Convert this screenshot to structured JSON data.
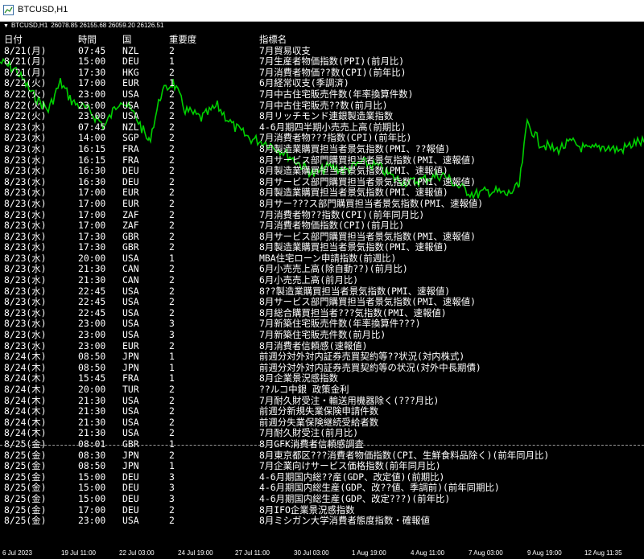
{
  "window": {
    "title": "BTCUSD,H1",
    "chart_header": {
      "symbol": "BTCUSD,H1",
      "ohlc": "26078.85 26155.68 26059.20 26126.51"
    }
  },
  "colors": {
    "background": "#000000",
    "price_line": "#00d000",
    "text": "#ffffff"
  },
  "table": {
    "headers": {
      "date": "日付",
      "time": "時間",
      "country": "国",
      "importance": "重要度",
      "indicator": "指標名"
    },
    "rows": [
      {
        "date": "8/21(月)",
        "time": "07:45",
        "country": "NZL",
        "importance": "2",
        "name": "7月貿易収支"
      },
      {
        "date": "8/21(月)",
        "time": "15:00",
        "country": "DEU",
        "importance": "1",
        "name": "7月生産者物価指数(PPI)(前月比)"
      },
      {
        "date": "8/21(月)",
        "time": "17:30",
        "country": "HKG",
        "importance": "2",
        "name": "7月消費者物価??数(CPI)(前年比)"
      },
      {
        "date": "8/22(火)",
        "time": "17:00",
        "country": "EUR",
        "importance": "1",
        "name": "6月経常収支(季調済)"
      },
      {
        "date": "8/22(火)",
        "time": "23:00",
        "country": "USA",
        "importance": "2",
        "name": "7月中古住宅販売件数(年率換算件数)"
      },
      {
        "date": "8/22(火)",
        "time": "23:00",
        "country": "USA",
        "importance": "2",
        "name": "7月中古住宅販売??数(前月比)"
      },
      {
        "date": "8/22(火)",
        "time": "23:00",
        "country": "USA",
        "importance": "2",
        "name": "8月リッチモンド連銀製造業指数"
      },
      {
        "date": "8/23(水)",
        "time": "07:45",
        "country": "NZL",
        "importance": "2",
        "name": "4-6月期四半期小売売上高(前期比)"
      },
      {
        "date": "8/23(水)",
        "time": "14:00",
        "country": "SGP",
        "importance": "2",
        "name": "7月消費者物???指数(CPI)(前年比)"
      },
      {
        "date": "8/23(水)",
        "time": "16:15",
        "country": "FRA",
        "importance": "2",
        "name": "8月製造業購買担当者景気指数(PMI、??報値)"
      },
      {
        "date": "8/23(水)",
        "time": "16:15",
        "country": "FRA",
        "importance": "2",
        "name": "8月サービス部門購買担当者景気指数(PMI、速報値)"
      },
      {
        "date": "8/23(水)",
        "time": "16:30",
        "country": "DEU",
        "importance": "2",
        "name": "8月製造業購買担当者景気指数(PMI、速報値)"
      },
      {
        "date": "8/23(水)",
        "time": "16:30",
        "country": "DEU",
        "importance": "2",
        "name": "8月サービス部門購買担当者景気指数(PMI、速報値)"
      },
      {
        "date": "8/23(水)",
        "time": "17:00",
        "country": "EUR",
        "importance": "2",
        "name": "8月製造業購買担当者景気指数(PMI、速報値)"
      },
      {
        "date": "8/23(水)",
        "time": "17:00",
        "country": "EUR",
        "importance": "2",
        "name": "8月サー???ス部門購買担当者景気指数(PMI、速報値)"
      },
      {
        "date": "8/23(水)",
        "time": "17:00",
        "country": "ZAF",
        "importance": "2",
        "name": "7月消費者物??指数(CPI)(前年同月比)"
      },
      {
        "date": "8/23(水)",
        "time": "17:00",
        "country": "ZAF",
        "importance": "2",
        "name": "7月消費者物価指数(CPI)(前月比)"
      },
      {
        "date": "8/23(水)",
        "time": "17:30",
        "country": "GBR",
        "importance": "2",
        "name": "8月サービス部門購買担当者景気指数(PMI、速報値)"
      },
      {
        "date": "8/23(水)",
        "time": "17:30",
        "country": "GBR",
        "importance": "2",
        "name": "8月製造業購買担当者景気指数(PMI、速報値)"
      },
      {
        "date": "8/23(水)",
        "time": "20:00",
        "country": "USA",
        "importance": "1",
        "name": "MBA住宅ローン申請指数(前週比)"
      },
      {
        "date": "8/23(水)",
        "time": "21:30",
        "country": "CAN",
        "importance": "2",
        "name": "6月小売売上高(除自動??)(前月比)"
      },
      {
        "date": "8/23(水)",
        "time": "21:30",
        "country": "CAN",
        "importance": "2",
        "name": "6月小売売上高(前月比)"
      },
      {
        "date": "8/23(水)",
        "time": "22:45",
        "country": "USA",
        "importance": "2",
        "name": "8??製造業購買担当者景気指数(PMI、速報値)"
      },
      {
        "date": "8/23(水)",
        "time": "22:45",
        "country": "USA",
        "importance": "2",
        "name": "8月サービス部門購買担当者景気指数(PMI、速報値)"
      },
      {
        "date": "8/23(水)",
        "time": "22:45",
        "country": "USA",
        "importance": "2",
        "name": "8月総合購買担当者???気指数(PMI、速報値)"
      },
      {
        "date": "8/23(水)",
        "time": "23:00",
        "country": "USA",
        "importance": "3",
        "name": "7月新築住宅販売件数(年率換算件???)"
      },
      {
        "date": "8/23(水)",
        "time": "23:00",
        "country": "USA",
        "importance": "3",
        "name": "7月新築住宅販売件数(前月比)"
      },
      {
        "date": "8/23(水)",
        "time": "23:00",
        "country": "EUR",
        "importance": "2",
        "name": "8月消費者信頼感(速報値)"
      },
      {
        "date": "8/24(木)",
        "time": "08:50",
        "country": "JPN",
        "importance": "1",
        "name": "前週分対外対内証券売買契約等??状況(対内株式)"
      },
      {
        "date": "8/24(木)",
        "time": "08:50",
        "country": "JPN",
        "importance": "1",
        "name": "前週分対外対内証券売買契約等の状況(対外中長期債)"
      },
      {
        "date": "8/24(木)",
        "time": "15:45",
        "country": "FRA",
        "importance": "1",
        "name": "8月企業景況感指数"
      },
      {
        "date": "8/24(木)",
        "time": "20:00",
        "country": "TUR",
        "importance": "2",
        "name": "??ルコ中銀 政策金利"
      },
      {
        "date": "8/24(木)",
        "time": "21:30",
        "country": "USA",
        "importance": "2",
        "name": "7月耐久財受注・輸送用機器除く(???月比)"
      },
      {
        "date": "8/24(木)",
        "time": "21:30",
        "country": "USA",
        "importance": "2",
        "name": "前週分新規失業保険申請件数"
      },
      {
        "date": "8/24(木)",
        "time": "21:30",
        "country": "USA",
        "importance": "2",
        "name": "前週分失業保険継続受給者数"
      },
      {
        "date": "8/24(木)",
        "time": "21:30",
        "country": "USA",
        "importance": "2",
        "name": "7月耐久財受注(前月比)"
      },
      {
        "date": "8/25(金)",
        "time": "08:01",
        "country": "GBR",
        "importance": "1",
        "name": "8月GFK消費者信頼感調査"
      },
      {
        "date": "8/25(金)",
        "time": "08:30",
        "country": "JPN",
        "importance": "2",
        "name": "8月東京都区???消費者物価指数(CPI、生鮮食料品除く)(前年同月比)"
      },
      {
        "date": "8/25(金)",
        "time": "08:50",
        "country": "JPN",
        "importance": "1",
        "name": "7月企業向けサービス価格指数(前年同月比)"
      },
      {
        "date": "8/25(金)",
        "time": "15:00",
        "country": "DEU",
        "importance": "3",
        "name": "4-6月期国内総??産(GDP、改定値)(前期比)"
      },
      {
        "date": "8/25(金)",
        "time": "15:00",
        "country": "DEU",
        "importance": "3",
        "name": "4-6月期国内総生産(GDP、改??値、季調前)(前年同期比)"
      },
      {
        "date": "8/25(金)",
        "time": "15:00",
        "country": "DEU",
        "importance": "3",
        "name": "4-6月期国内総生産(GDP、改定???)(前年比)"
      },
      {
        "date": "8/25(金)",
        "time": "17:00",
        "country": "DEU",
        "importance": "2",
        "name": "8月IFO企業景況感指数"
      },
      {
        "date": "8/25(金)",
        "time": "23:00",
        "country": "USA",
        "importance": "2",
        "name": "8月ミシガン大学消費者態度指数・確報値"
      }
    ]
  },
  "x_axis_labels": [
    "6 Jul 2023",
    "19 Jul 11:00",
    "22 Jul 03:00",
    "24 Jul 19:00",
    "27 Jul 11:00",
    "30 Jul 03:00",
    "1 Aug 19:00",
    "4 Aug 11:00",
    "7 Aug 03:00",
    "9 Aug 19:00",
    "12 Aug 11:35"
  ]
}
